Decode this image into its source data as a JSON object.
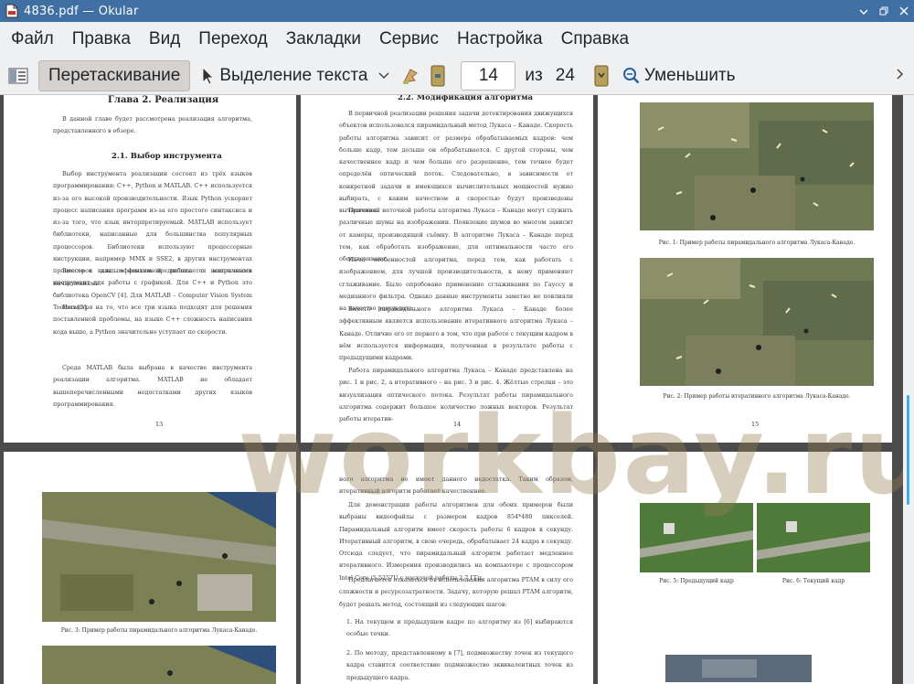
{
  "window": {
    "title": "4836.pdf — Okular"
  },
  "menu": [
    "Файл",
    "Правка",
    "Вид",
    "Переход",
    "Закладки",
    "Сервис",
    "Настройка",
    "Справка"
  ],
  "toolbar": {
    "drag_label": "Перетаскивание",
    "select_label": "Выделение текста",
    "page_value": "14",
    "of_label": "из",
    "total_pages": "24",
    "zoom_out_label": "Уменьшить"
  },
  "pages": {
    "p13": {
      "chapter": "Глава 2. Реализация",
      "intro": "В данной главе будет рассмотрена реализация алгоритма, представленного в обзоре.",
      "section": "2.1. Выбор инструмента",
      "p1": "Выбор инструмента реализации состоял из трёх языков программирования: C++, Python и MATLAB. C++ используется из-за его высокой производительности. Язык Python ускоряет процесс написания программ из-за его простого синтаксиса и из-за того, что язык интерпретируемый. MATLAB использует библиотеки, написанные для большинства популярных процессоров. Библиотеки используют процессорные инструкции, например MMX и SSE2, в других инструментах процессоров для эффективной работы с матричными вычислениями.",
      "p2": "Вместе с каждым языком предполагается использовать инструмент для работы с графикой. Для C++ и Python это библиотека OpenCV [4]. Для MATLAB – Computer Vision System Toolbox [5].",
      "p3": "Несмотря на то, что все три языка подходят для решения поставленной проблемы, на языке C++ сложность написания кода выше, а Python значительно уступает по скорости.",
      "p4": "Среда MATLAB была выбрана в качестве инструмента реализации алгоритма. MATLAB не обладает вышеперечисленными недостатками других языков программирования.",
      "num": "13"
    },
    "p14": {
      "section": "2.2. Модификация алгоритма",
      "p1": "В первичной реализации решения задачи детектирования движущихся объектов использовался пирамидальный метод Лукаса – Канаде. Скорость работы алгоритма зависит от размера обрабатываемых кадров: чем больше кадр, тем дольше он обрабатывается. С другой стороны, чем качественнее кадр и чем больше его разрешение, тем точнее будет определён оптический поток. Следовательно, в зависимости от конкретной задачи и имеющихся вычислительных мощностей нужно выбирать, с каким качеством и скоростью будут произведены вычисления.",
      "p2": "Причиной неточной работы алгоритма Лукаса – Канаде могут служить различные шумы на изображении. Появление шумов во многом зависит от камеры, производящей съёмку. В алгоритме Лукаса – Канаде перед тем, как обработать изображение, для оптимальности часто его обесцвечивают.",
      "p3": "Из-за особенностей алгоритма, перед тем, как работать с изображением, для лучшей производительности, к нему применяют сглаживание. Было опробовано применение сглаживания по Гауссу и медианного фильтра. Однако данные инструменты заметно не повлияли на качество результата.",
      "p4": "Вместо пирамидального алгоритма Лукаса – Канаде более эффективным является использование итеративного алгоритма Лукаса – Канаде. Отличие его от первого в том, что при работе с текущим кадром в нём используется информация, полученная в результате работы с предыдущими кадрами.",
      "p5": "Работа пирамидального алгоритма Лукаса – Канаде представлена на рис. 1 и рис. 2, а итеративного – на рис. 3 и рис. 4. Жёлтые стрелки – это визуализация оптического потока. Результат работы пирамидального алгоритма содержит большое количество ложных векторов. Результат работы итератив-",
      "num": "14"
    },
    "p15": {
      "cap1": "Рис. 1: Пример работы пирамидального алгоритма Лукаса-Канаде.",
      "cap2": "Рис. 2: Пример работы итеративного алгоритма Лукаса-Канаде.",
      "num": "15"
    },
    "p16": {
      "cap3": "Рис. 3: Пример работы пирамидального алгоритма Лукаса-Канаде."
    },
    "p17": {
      "p1": "ного алгоритма не имеет данного недостатка. Таким образом, итеративный алгоритм работает качественнее.",
      "p2": "Для демонстрации работы алгоритмов для обоих примеров были выбраны видеофайлы с размером кадров 854*480 пикселей. Пирамидальный алгоритм имеет скорость работы 6 кадров в секунду. Итеративный алгоритм, в свою очередь, обрабатывает 24 кадра в секунду. Отсюда следует, что пирамидальный алгоритм работает медленнее итеративного. Измерения производились на компьютере с процессором Intel Core i5-5257U с частотой работы 2.7 ГГц.",
      "p3": "Предлагается отказаться от использования алгоритма PTAM в силу его сложности и ресурсозатратности. Задачу, которую решал PTAM алгоритм, будет решать метод, состоящий из следующих шагов:",
      "li1": "1.  На текущем и предыдущем кадре по алгоритму из [6] выбираются особые точки.",
      "li2": "2.  По методу, представленному в [7], подмножеству точек из текущего кадра ставится соответствие подмножество эквивалентных точек из предыдущего кадра."
    },
    "p18": {
      "cap5": "Рис. 5: Предыдущий кадр",
      "cap6": "Рис. 6: Текущий кадр"
    }
  },
  "watermark": "workbay.ru"
}
